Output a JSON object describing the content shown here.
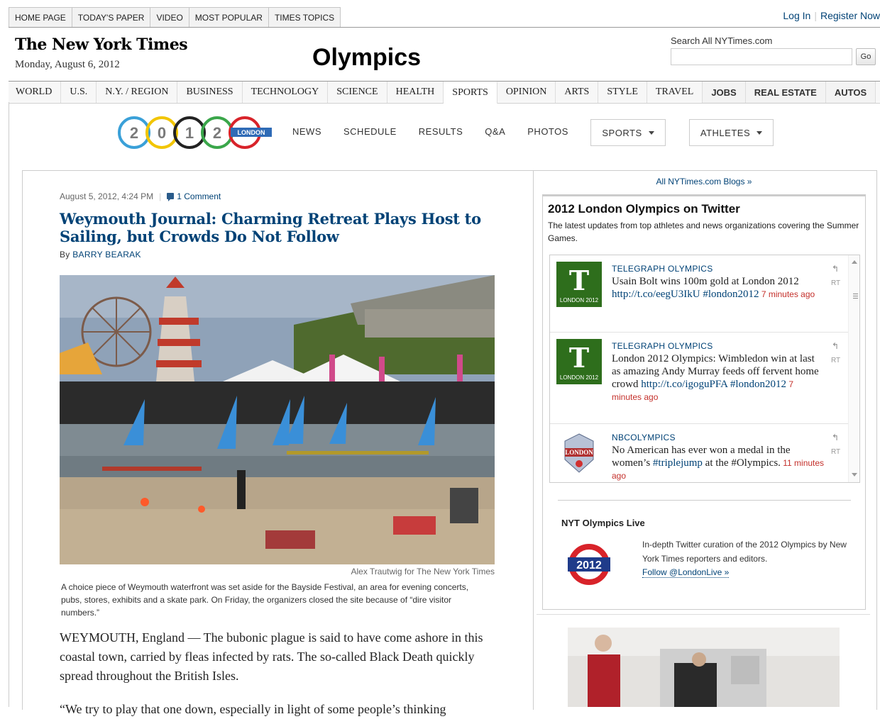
{
  "top_tabs": [
    "HOME PAGE",
    "TODAY'S PAPER",
    "VIDEO",
    "MOST POPULAR",
    "TIMES TOPICS"
  ],
  "auth": {
    "login": "Log In",
    "register": "Register Now"
  },
  "masthead": {
    "logo": "The New York Times",
    "date": "Monday, August 6, 2012",
    "section_title": "Olympics"
  },
  "search": {
    "label": "Search All NYTimes.com",
    "value": "",
    "go": "Go"
  },
  "section_nav": [
    "WORLD",
    "U.S.",
    "N.Y. / REGION",
    "BUSINESS",
    "TECHNOLOGY",
    "SCIENCE",
    "HEALTH",
    "SPORTS",
    "OPINION",
    "ARTS",
    "STYLE",
    "TRAVEL",
    "JOBS",
    "REAL ESTATE",
    "AUTOS"
  ],
  "olympics_nav": {
    "logo_digits": [
      "2",
      "0",
      "1",
      "2"
    ],
    "logo_tag": "LONDON",
    "items": [
      "NEWS",
      "SCHEDULE",
      "RESULTS",
      "Q&A",
      "PHOTOS"
    ],
    "dropdowns": [
      "SPORTS",
      "ATHLETES"
    ]
  },
  "article": {
    "dateline": "August 5, 2012, 4:24 PM",
    "comments": "1 Comment",
    "headline": "Weymouth Journal: Charming Retreat Plays Host to Sailing, but Crowds Do Not Follow",
    "by": "By",
    "author": "BARRY BEARAK",
    "photo_credit": "Alex Trautwig for The New York Times",
    "caption": "A choice piece of Weymouth waterfront was set aside for the Bayside Festival, an area for evening concerts, pubs, stores, exhibits and a skate park. On Friday, the organizers closed the site because of “dire visitor numbers.”",
    "para1": "WEYMOUTH, England — The bubonic plague is said to have come ashore in this coastal town, carried by fleas infected by rats. The so-called Black Death quickly spread throughout the British Isles.",
    "para2": "“We try to play that one down, especially in light of some people’s thinking"
  },
  "sidebar": {
    "all_blogs": "All NYTimes.com Blogs »",
    "twitter": {
      "title": "2012 London Olympics on Twitter",
      "description": "The latest updates from top athletes and news organizations covering the Summer Games.",
      "tweets": [
        {
          "account": "TELEGRAPH OLYMPICS",
          "avatar_letter": "T",
          "avatar_tag": "LONDON 2012",
          "text": "Usain Bolt wins 100m gold at London 2012 ",
          "link": "http://t.co/eegU3IkU",
          "tag": " #london2012",
          "ago": " 7 minutes ago",
          "rt": "RT"
        },
        {
          "account": "TELEGRAPH OLYMPICS",
          "avatar_letter": "T",
          "avatar_tag": "LONDON 2012",
          "text": "London 2012 Olympics: Wimbledon win at last as amazing Andy Murray feeds off fervent home crowd ",
          "link": "http://t.co/igoguPFA",
          "tag": " #london2012",
          "ago": " 7 minutes ago",
          "rt": "RT"
        },
        {
          "account": "NBCOLYMPICS",
          "avatar_letter": "LONDON",
          "avatar_tag": "",
          "text": "No American has ever won a medal in the women’s ",
          "link": "#triplejump",
          "tag": " at the #Olympics.",
          "ago": " 11 minutes ago",
          "rt": "RT"
        }
      ]
    },
    "live": {
      "title": "NYT Olympics Live",
      "logo_text": "2012",
      "description": "In-depth Twitter curation of the 2012 Olympics by New York Times reporters and editors.",
      "follow": "Follow @LondonLive »"
    }
  },
  "colors": {
    "link": "#004276",
    "timestamp": "#c4302b",
    "telegraph_green": "#2e6e1c"
  }
}
